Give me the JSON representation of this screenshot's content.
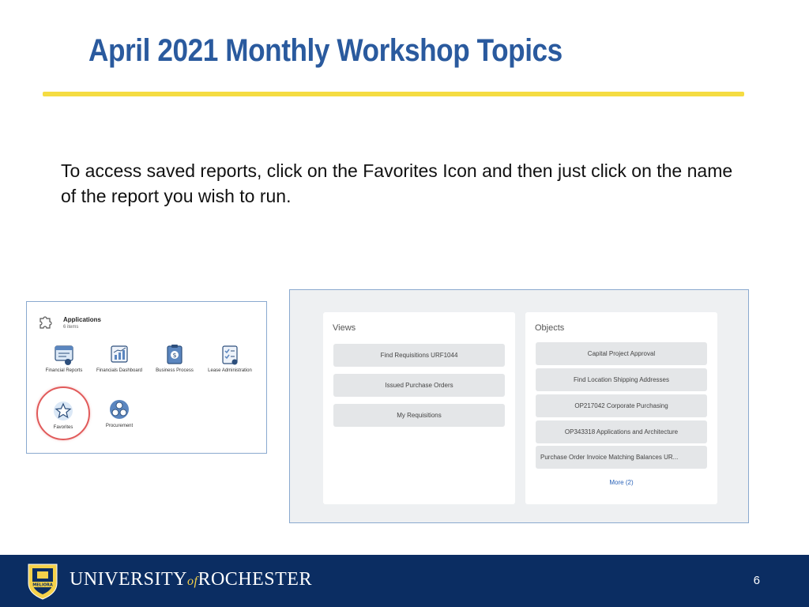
{
  "slide": {
    "title": "April 2021 Monthly Workshop Topics",
    "body": "To access saved reports, click on the Favorites Icon and then just click on the name of the report you wish to run.",
    "page_number": "6"
  },
  "applications": {
    "title": "Applications",
    "count": "6 items",
    "items": [
      {
        "label": "Financial Reports",
        "icon": "report-icon"
      },
      {
        "label": "Financials Dashboard",
        "icon": "dashboard-chart-icon"
      },
      {
        "label": "Business Process",
        "icon": "clipboard-dollar-icon"
      },
      {
        "label": "Lease Administration",
        "icon": "checklist-icon"
      },
      {
        "label": "Favorites",
        "icon": "star-icon"
      },
      {
        "label": "Procurement",
        "icon": "procurement-icon"
      }
    ]
  },
  "views": {
    "title": "Views",
    "items": [
      "Find Requisitions URF1044",
      "Issued Purchase Orders",
      "My Requisitions"
    ]
  },
  "objects": {
    "title": "Objects",
    "items": [
      "Capital Project Approval",
      "Find Location Shipping Addresses",
      "OP217042 Corporate Purchasing",
      "OP343318 Applications and Architecture",
      "Purchase Order Invoice Matching Balances UR..."
    ],
    "more": "More (2)"
  },
  "footer": {
    "university": "UNIVERSITY",
    "of": "of",
    "rochester": "ROCHESTER",
    "seal_text": "MELIORA",
    "brand_color": "#0b2d62",
    "accent_color": "#f5dc42"
  }
}
